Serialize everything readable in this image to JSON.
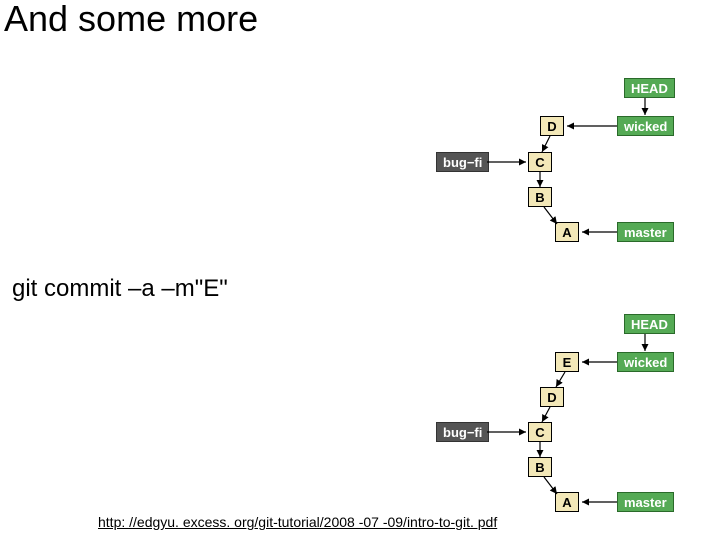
{
  "slide": {
    "title": "And some more",
    "command": "git commit –a –m\"E\"",
    "footer_url": "http: //edgyu. excess. org/git-tutorial/2008 -07 -09/intro-to-git. pdf"
  },
  "labels": {
    "head": "HEAD",
    "wicked": "wicked",
    "master": "master",
    "bugfi": "bug−fi"
  },
  "diagram1": {
    "commits": {
      "A": "A",
      "B": "B",
      "C": "C",
      "D": "D"
    }
  },
  "diagram2": {
    "commits": {
      "A": "A",
      "B": "B",
      "C": "C",
      "D": "D",
      "E": "E"
    }
  }
}
